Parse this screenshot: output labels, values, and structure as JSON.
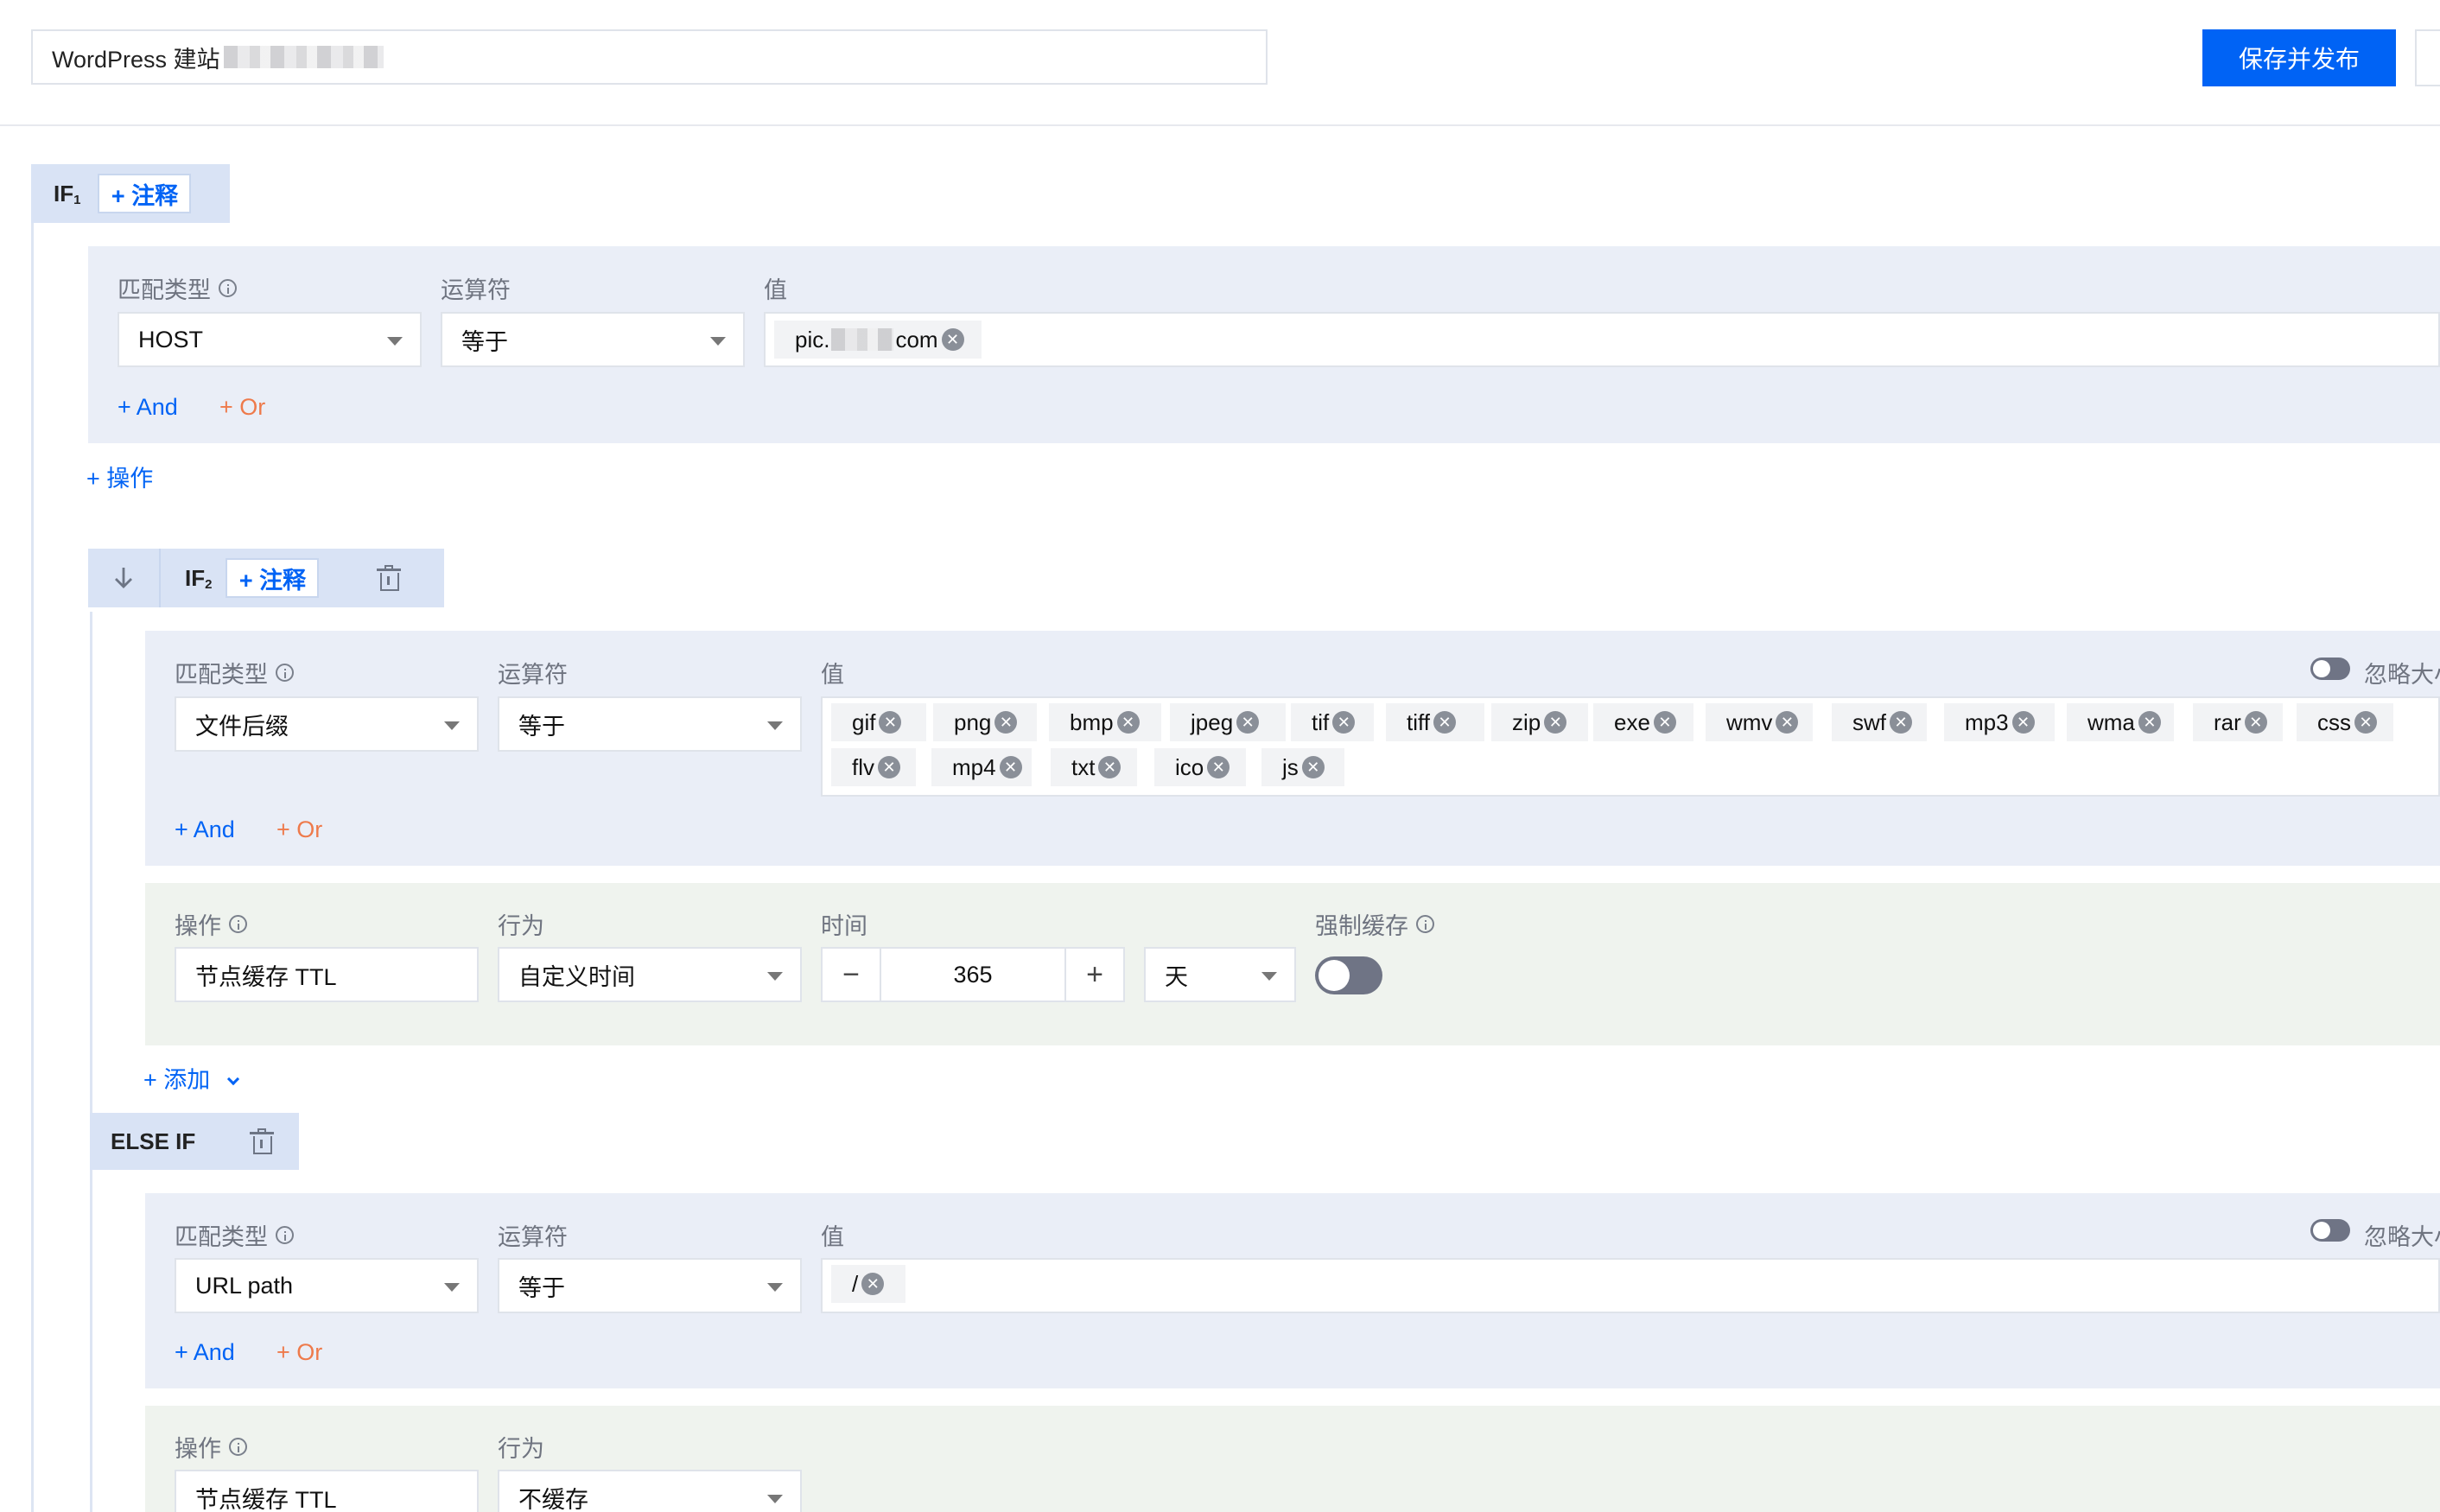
{
  "header": {
    "title_value": "WordPress 建站",
    "publish_label": "保存并发布"
  },
  "labels": {
    "match_type": "匹配类型",
    "operator": "运算符",
    "value": "值",
    "operation": "操作",
    "behavior": "行为",
    "time": "时间",
    "force_cache": "强制缓存",
    "ignore_case": "忽略大小",
    "and": "+ And",
    "or": "+ Or",
    "add_note": "+ 注释",
    "add_operation": "+ 操作",
    "add": "+ 添加"
  },
  "if1": {
    "label": "IF",
    "index": "1",
    "match_type": "HOST",
    "operator": "等于",
    "values": [
      "pic.",
      "com"
    ]
  },
  "if2": {
    "label": "IF",
    "index": "2",
    "match_type": "文件后缀",
    "operator": "等于",
    "values": [
      "gif",
      "png",
      "bmp",
      "jpeg",
      "tif",
      "tiff",
      "zip",
      "exe",
      "wmv",
      "swf",
      "mp3",
      "wma",
      "rar",
      "css",
      "flv",
      "mp4",
      "txt",
      "ico",
      "js"
    ],
    "action": {
      "operation": "节点缓存 TTL",
      "behavior": "自定义时间",
      "time_value": "365",
      "time_unit": "天",
      "minus": "−",
      "plus": "+"
    }
  },
  "else_if": {
    "label": "ELSE IF",
    "match_type": "URL path",
    "operator": "等于",
    "values": [
      "/"
    ],
    "action": {
      "operation": "节点缓存 TTL",
      "behavior": "不缓存"
    }
  },
  "icons": {
    "remove": "close-circle-icon",
    "info": "info-icon",
    "trash": "trash-icon",
    "down": "arrow-down-icon",
    "caret": "caret-down-icon"
  },
  "colors": {
    "primary": "#0063f5",
    "or_link": "#ee7a4b",
    "condition_bg": "#eaeef7",
    "action_bg": "#eff3ee",
    "tab_bg": "#d9e3f5"
  }
}
